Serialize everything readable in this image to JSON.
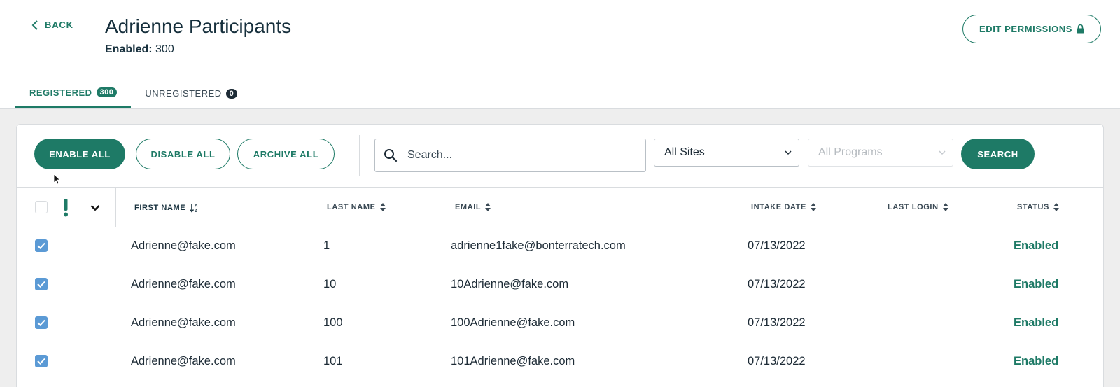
{
  "header": {
    "back_label": "BACK",
    "title": "Adrienne Participants",
    "enabled_label": "Enabled:",
    "enabled_count": "300",
    "edit_permissions_label": "EDIT PERMISSIONS"
  },
  "tabs": [
    {
      "label": "REGISTERED",
      "count": "300",
      "active": true
    },
    {
      "label": "UNREGISTERED",
      "count": "0",
      "active": false
    }
  ],
  "toolbar": {
    "enable_all": "ENABLE ALL",
    "disable_all": "DISABLE ALL",
    "archive_all": "ARCHIVE ALL",
    "search_placeholder": "Search...",
    "site_select": "All Sites",
    "program_select": "All Programs",
    "search_button": "SEARCH"
  },
  "table": {
    "columns": [
      "FIRST NAME",
      "LAST NAME",
      "EMAIL",
      "INTAKE DATE",
      "LAST LOGIN",
      "STATUS"
    ],
    "rows": [
      {
        "first": "Adrienne@fake.com",
        "last": "1",
        "email": "adrienne1fake@bonterratech.com",
        "intake": "07/13/2022",
        "login": "",
        "status": "Enabled",
        "checked": true
      },
      {
        "first": "Adrienne@fake.com",
        "last": "10",
        "email": "10Adrienne@fake.com",
        "intake": "07/13/2022",
        "login": "",
        "status": "Enabled",
        "checked": true
      },
      {
        "first": "Adrienne@fake.com",
        "last": "100",
        "email": "100Adrienne@fake.com",
        "intake": "07/13/2022",
        "login": "",
        "status": "Enabled",
        "checked": true
      },
      {
        "first": "Adrienne@fake.com",
        "last": "101",
        "email": "101Adrienne@fake.com",
        "intake": "07/13/2022",
        "login": "",
        "status": "Enabled",
        "checked": true
      }
    ]
  },
  "colors": {
    "accent": "#1e7a66",
    "text": "#1d2b36",
    "checkbox": "#5b9ad5",
    "background": "#eeeeee"
  }
}
